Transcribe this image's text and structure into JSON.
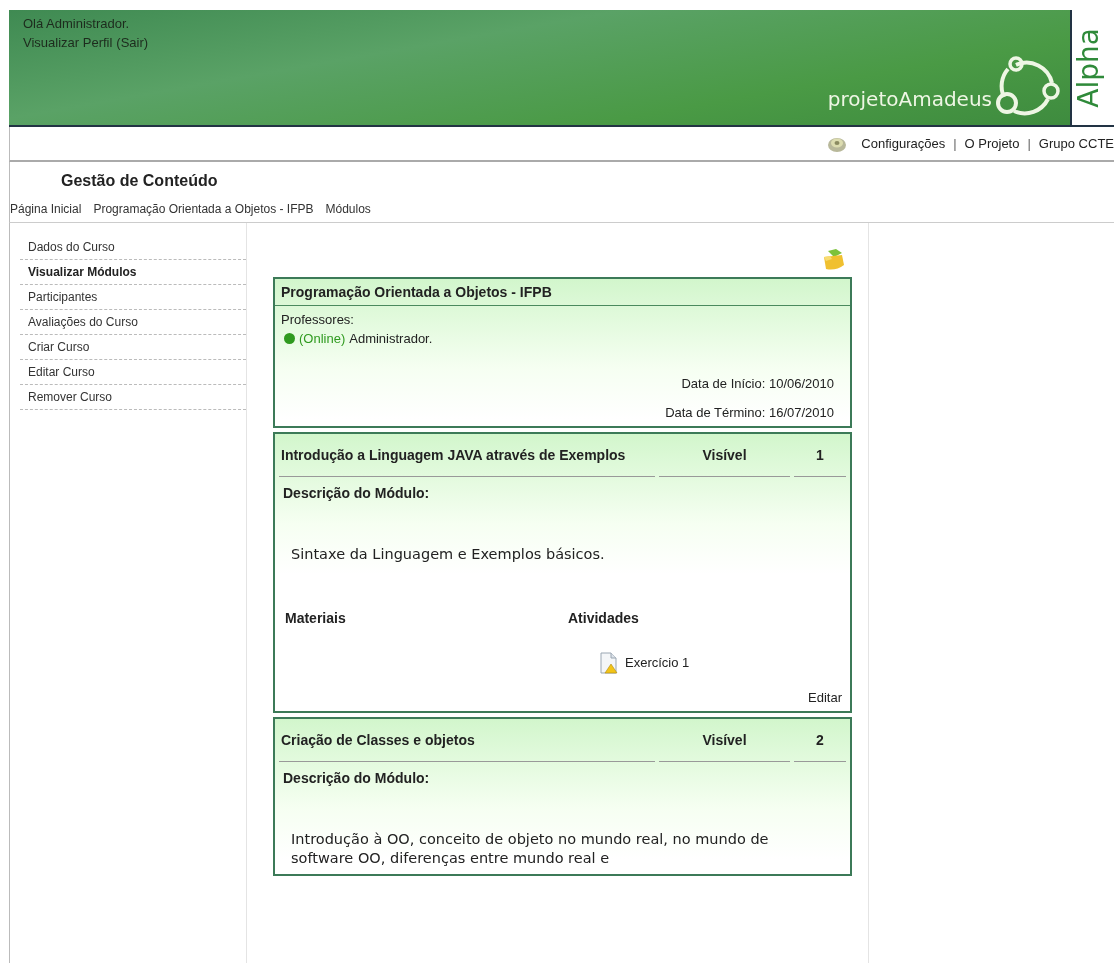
{
  "header": {
    "greeting": "Olá Administrador.",
    "profile_link": "Visualizar Perfil",
    "logout_link": "(Sair)",
    "logo_text": "projetoAmadeus",
    "badge": "Alpha"
  },
  "top_links": [
    "Configurações",
    "O Projeto",
    "Grupo CCTE"
  ],
  "top_separator": "|",
  "page_title": "Gestão de Conteúdo",
  "breadcrumb": [
    "Página Inicial",
    "Programação Orientada a Objetos - IFPB",
    "Módulos"
  ],
  "sidebar": {
    "items": [
      {
        "label": "Dados do Curso",
        "selected": false
      },
      {
        "label": "Visualizar Módulos",
        "selected": true
      },
      {
        "label": "Participantes",
        "selected": false
      },
      {
        "label": "Avaliações do Curso",
        "selected": false
      },
      {
        "label": "Criar Curso",
        "selected": false
      },
      {
        "label": "Editar Curso",
        "selected": false
      },
      {
        "label": "Remover Curso",
        "selected": false
      }
    ]
  },
  "course": {
    "title": "Programação Orientada a Objetos - IFPB",
    "professors_label": "Professores:",
    "professors": [
      {
        "status": "(Online)",
        "name": "Administrador.",
        "color": "#2f9a1f"
      }
    ],
    "start": "Data de Início: 10/06/2010",
    "end": "Data de Término: 16/07/2010"
  },
  "modules": [
    {
      "title": "Introdução a Linguagem JAVA através de Exemplos",
      "visibility": "Visível",
      "number": "1",
      "description_label": "Descrição do Módulo:",
      "description": "Sintaxe da Linguagem e Exemplos básicos.",
      "materials_label": "Materiais",
      "activities_label": "Atividades",
      "activities": [
        "Exercício 1"
      ],
      "edit": "Editar"
    },
    {
      "title": "Criação de Classes e objetos",
      "visibility": "Visível",
      "number": "2",
      "description_label": "Descrição do Módulo:",
      "description": "Introdução à OO, conceito de objeto no mundo real, no mundo de software OO, diferenças entre mundo real e"
    }
  ]
}
